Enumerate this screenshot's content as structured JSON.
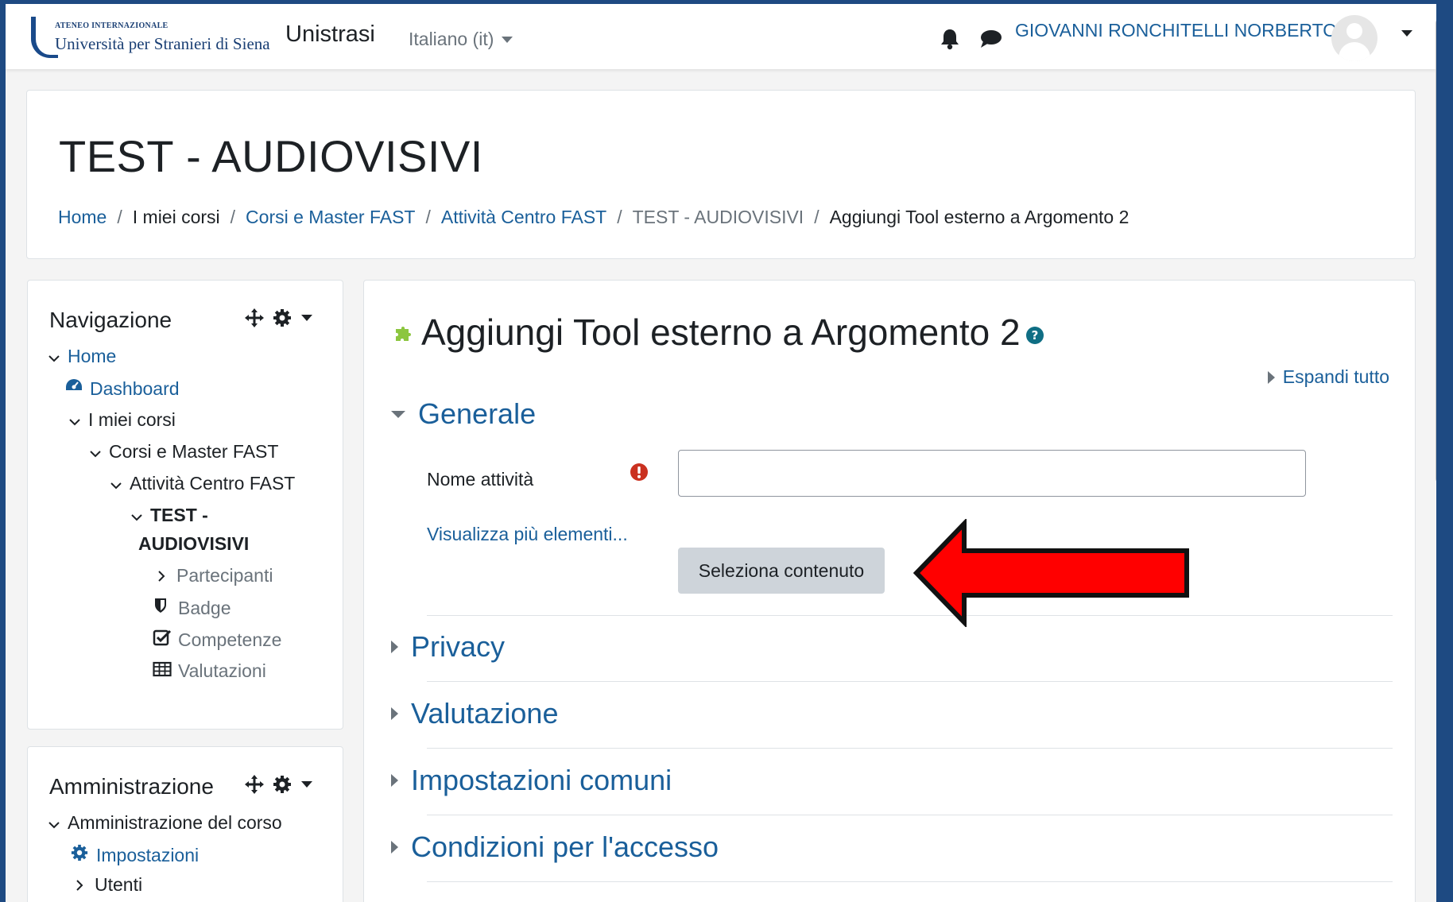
{
  "header": {
    "logo_small": "ATENEO INTERNAZIONALE",
    "logo_main": "Università per Stranieri di Siena",
    "site_name": "Unistrasi",
    "language": "Italiano (it)",
    "user_name": "GIOVANNI RONCHITELLI NORBERTO"
  },
  "page": {
    "course_title": "TEST - AUDIOVISIVI",
    "breadcrumb": [
      "Home",
      "I miei corsi",
      "Corsi e Master FAST",
      "Attività Centro FAST",
      "TEST - AUDIOVISIVI",
      "Aggiungi Tool esterno a Argomento 2"
    ]
  },
  "navigation_block": {
    "title": "Navigazione",
    "items": {
      "home": "Home",
      "dashboard": "Dashboard",
      "my_courses": "I miei corsi",
      "corsi_master": "Corsi e Master FAST",
      "attivita": "Attività Centro FAST",
      "test_line1": "TEST -",
      "test_line2": "AUDIOVISIVI",
      "participants": "Partecipanti",
      "badge": "Badge",
      "competenze": "Competenze",
      "valutazioni": "Valutazioni"
    }
  },
  "admin_block": {
    "title": "Amministrazione",
    "items": {
      "course_admin": "Amministrazione del corso",
      "settings": "Impostazioni",
      "users": "Utenti"
    }
  },
  "main": {
    "title": "Aggiungi Tool esterno a Argomento 2",
    "expand_all": "Espandi tutto",
    "sections": {
      "generale": "Generale",
      "privacy": "Privacy",
      "valutazione": "Valutazione",
      "impostazioni_comuni": "Impostazioni comuni",
      "condizioni": "Condizioni per l'accesso"
    },
    "field_label": "Nome attività",
    "field_value": "",
    "more_link": "Visualizza più elementi...",
    "select_button": "Seleziona contenuto"
  },
  "colors": {
    "link": "#1a5f9a",
    "frame": "#1e4a82",
    "required": "#ca3120",
    "arrow": "#ff0000",
    "button_bg": "#ced4da"
  }
}
